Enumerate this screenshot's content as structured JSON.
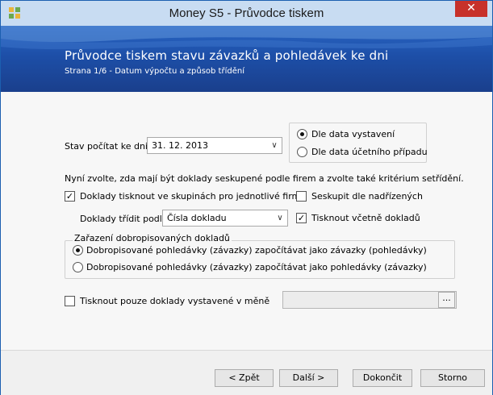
{
  "window": {
    "title": "Money S5 - Průvodce tiskem",
    "close_label": "✕"
  },
  "banner": {
    "title": "Průvodce tiskem stavu závazků a pohledávek ke dni",
    "subtitle": "Strana 1/6 - Datum výpočtu a způsob třídění"
  },
  "form": {
    "date_label": "Stav počítat ke dni",
    "date_value": "31. 12. 2013",
    "radio_issue_date": "Dle data vystavení",
    "radio_accounting_date": "Dle data účetního případu",
    "instruction": "Nyní zvolte, zda mají být doklady seskupené podle firem a zvolte také kritérium setřídění.",
    "check_group_by_firm": "Doklady tisknout ve skupinách pro jednotlivé firmy",
    "check_group_by_parent": "Seskupit dle nadřízených",
    "sort_label": "Doklady třídit podle",
    "sort_value": "Čísla dokladu",
    "check_print_including": "Tisknout včetně dokladů",
    "credit_group_label": "Zařazení dobropisovaných dokladů",
    "credit_option_1": "Dobropisované pohledávky (závazky) započítávat jako závazky (pohledávky)",
    "credit_option_2": "Dobropisované pohledávky (závazky) započítávat jako pohledávky (závazky)",
    "check_currency_only": "Tisknout pouze doklady vystavené v měně",
    "currency_browse": "..."
  },
  "buttons": {
    "back": "< Zpět",
    "next": "Další >",
    "finish": "Dokončit",
    "cancel": "Storno"
  },
  "state": {
    "radio_date_selected": "issue",
    "group_by_firm_checked": true,
    "group_by_parent_checked": false,
    "print_including_checked": true,
    "credit_option_selected": 1,
    "currency_only_checked": false
  }
}
